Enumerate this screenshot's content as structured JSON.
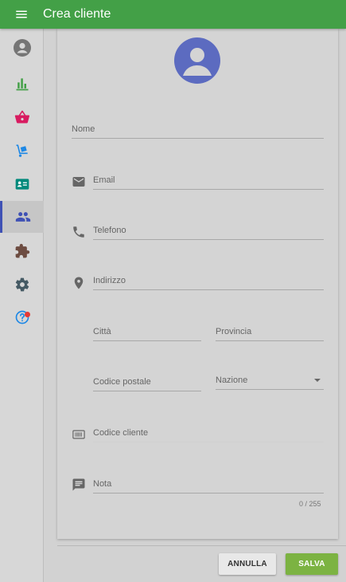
{
  "header": {
    "title": "Crea cliente",
    "menu_icon": "menu-icon"
  },
  "sidebar": {
    "items": [
      {
        "name": "account-icon",
        "active": false
      },
      {
        "name": "bar-chart-icon",
        "active": false
      },
      {
        "name": "shopping-basket-icon",
        "active": false
      },
      {
        "name": "dolly-icon",
        "active": false
      },
      {
        "name": "id-card-icon",
        "active": false
      },
      {
        "name": "people-icon",
        "active": true
      },
      {
        "name": "puzzle-icon",
        "active": false
      },
      {
        "name": "settings-icon",
        "active": false
      },
      {
        "name": "help-icon",
        "active": false,
        "badge": true
      }
    ]
  },
  "form": {
    "nome": {
      "label": "Nome"
    },
    "email": {
      "label": "Email"
    },
    "telefono": {
      "label": "Telefono"
    },
    "indirizzo": {
      "label": "Indirizzo"
    },
    "citta": {
      "label": "Città"
    },
    "provincia": {
      "label": "Provincia"
    },
    "codice_postale": {
      "label": "Codice postale"
    },
    "nazione": {
      "label": "Nazione"
    },
    "codice_cliente": {
      "label": "Codice cliente"
    },
    "nota": {
      "label": "Nota",
      "counter": "0 / 255"
    }
  },
  "actions": {
    "cancel_label": "ANNULLA",
    "save_label": "SALVA"
  },
  "colors": {
    "header": "#43a047",
    "active_indicator": "#3f51b5",
    "save": "#7cb342",
    "highlight": "#ed8a3c"
  }
}
